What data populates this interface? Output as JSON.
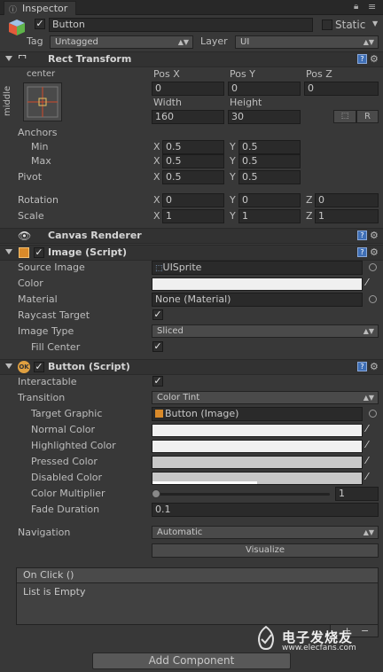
{
  "window": {
    "tab_title": "Inspector",
    "lock_icon": "lock-icon",
    "menu_icon": "menu-icon"
  },
  "gameobject": {
    "name": "Button",
    "active": true,
    "static_label": "Static",
    "static_checked": false,
    "tag_label": "Tag",
    "tag_value": "Untagged",
    "layer_label": "Layer",
    "layer_value": "UI"
  },
  "rect_transform": {
    "title": "Rect Transform",
    "anchor_preset_top": "center",
    "anchor_preset_side": "middle",
    "pos_x_label": "Pos X",
    "pos_y_label": "Pos Y",
    "pos_z_label": "Pos Z",
    "pos_x": "0",
    "pos_y": "0",
    "pos_z": "0",
    "width_label": "Width",
    "height_label": "Height",
    "width": "160",
    "height": "30",
    "raw_button": "R",
    "anchors_label": "Anchors",
    "min_label": "Min",
    "max_label": "Max",
    "min_x": "0.5",
    "min_y": "0.5",
    "max_x": "0.5",
    "max_y": "0.5",
    "pivot_label": "Pivot",
    "pivot_x": "0.5",
    "pivot_y": "0.5",
    "rotation_label": "Rotation",
    "rot_x": "0",
    "rot_y": "0",
    "rot_z": "0",
    "scale_label": "Scale",
    "scale_x": "1",
    "scale_y": "1",
    "scale_z": "1",
    "x": "X",
    "y": "Y",
    "z": "Z"
  },
  "canvas_renderer": {
    "title": "Canvas Renderer"
  },
  "image": {
    "title": "Image (Script)",
    "source_image_label": "Source Image",
    "source_image_value": "UISprite",
    "color_label": "Color",
    "material_label": "Material",
    "material_value": "None (Material)",
    "raycast_label": "Raycast Target",
    "image_type_label": "Image Type",
    "image_type_value": "Sliced",
    "fill_center_label": "Fill Center"
  },
  "button": {
    "title": "Button (Script)",
    "interactable_label": "Interactable",
    "transition_label": "Transition",
    "transition_value": "Color Tint",
    "target_graphic_label": "Target Graphic",
    "target_graphic_value": "Button (Image)",
    "normal_color_label": "Normal Color",
    "highlighted_color_label": "Highlighted Color",
    "pressed_color_label": "Pressed Color",
    "disabled_color_label": "Disabled Color",
    "color_multiplier_label": "Color Multiplier",
    "color_multiplier_value": "1",
    "fade_duration_label": "Fade Duration",
    "fade_duration_value": "0.1",
    "navigation_label": "Navigation",
    "navigation_value": "Automatic",
    "visualize_label": "Visualize",
    "on_click_label": "On Click ()",
    "list_empty_label": "List is Empty"
  },
  "add_component_label": "Add Component",
  "watermark": {
    "line1": "电子发烧友",
    "line2": "www.elecfans.com"
  },
  "colors": {
    "background": "#383838",
    "field": "#2a2a2a",
    "white_swatch": "#f0f0f0",
    "pressed_swatch": "#c8c8c8",
    "disabled_swatch": "#c8c8c8",
    "help_icon": "#3f6fb6"
  }
}
